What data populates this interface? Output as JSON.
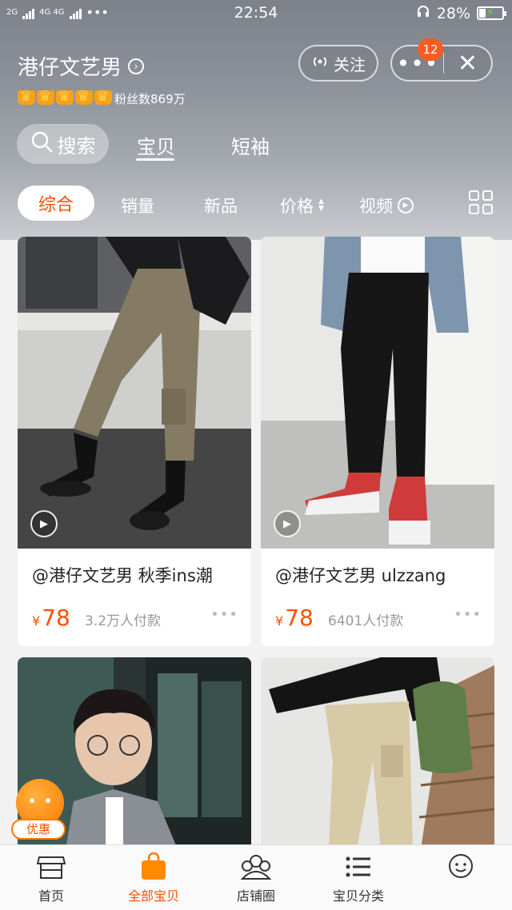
{
  "status_bar": {
    "net_left": "2G",
    "net_right": "4G 4G",
    "dots": "•••",
    "time": "22:54",
    "battery": "28%"
  },
  "store": {
    "name": "港仔文艺男",
    "crown_count": 5,
    "fans": "粉丝数869万",
    "follow_label": "关注",
    "more_label": "•••",
    "notification_count": "12",
    "close_label": "✕"
  },
  "top_tabs": {
    "search_label": "搜索",
    "tabs": [
      "宝贝",
      "短袖"
    ],
    "active_tab": "宝贝"
  },
  "sort_bar": {
    "items": [
      "综合",
      "销量",
      "新品",
      "价格",
      "视频"
    ],
    "active": "综合"
  },
  "products": [
    {
      "title": "@港仔文艺男 秋季ins潮",
      "currency": "¥",
      "price": "78",
      "sales": "3.2万人付款",
      "more": "•••",
      "has_video": true
    },
    {
      "title": "@港仔文艺男 ulzzang",
      "currency": "¥",
      "price": "78",
      "sales": "6401人付款",
      "more": "•••",
      "has_video": true
    },
    {
      "has_video": false
    },
    {
      "has_video": false
    }
  ],
  "promo": {
    "label": "优惠"
  },
  "bottom_nav": [
    {
      "label": "首页",
      "icon": "home-store-icon",
      "active": false
    },
    {
      "label": "全部宝贝",
      "icon": "shopping-bag-icon",
      "active": true
    },
    {
      "label": "店铺圈",
      "icon": "community-icon",
      "active": false
    },
    {
      "label": "宝贝分类",
      "icon": "category-list-icon",
      "active": false
    },
    {
      "label": "",
      "icon": "chat-bubble-icon",
      "active": false
    }
  ],
  "colors": {
    "accent": "#ff5000",
    "badge": "#ff5a1f",
    "crown": "#f7a21b"
  }
}
